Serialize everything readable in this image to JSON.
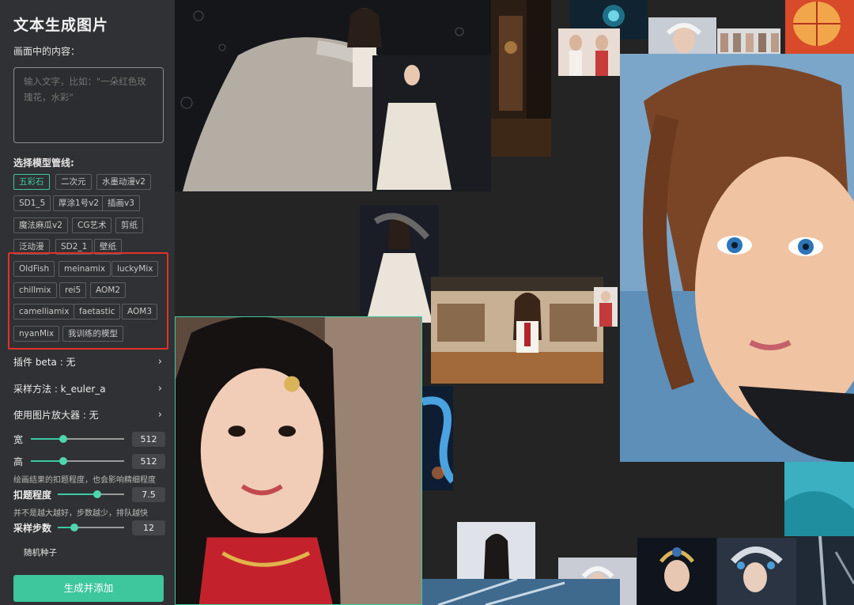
{
  "sidebar": {
    "title": "文本生成图片",
    "prompt_label": "画面中的内容：",
    "prompt_placeholder": "输入文字，比如：\"一朵红色玫瑰花，水彩\"",
    "pipeline_label": "选择模型管线:",
    "chips": [
      "五彩石",
      "二次元",
      "水墨动漫v2",
      "SD1_5",
      "厚涂1号v2",
      "插画v3",
      "魔法麻瓜v2",
      "CG艺术",
      "剪纸",
      "泛动漫",
      "SD2_1",
      "壁纸",
      "OldFish",
      "meinamix",
      "luckyMix",
      "chillmix",
      "rei5",
      "AOM2",
      "camelliamix",
      "faetastic",
      "AOM3",
      "nyanMix",
      "我训练的模型"
    ],
    "active_chip": "五彩石",
    "plugin_label": "插件 beta : 无",
    "sampler_label": "采样方法 : k_euler_a",
    "upscaler_label": "使用图片放大器 : 无",
    "width_label": "宽",
    "width_value": "512",
    "width_fraction": 0.35,
    "height_label": "高",
    "height_value": "512",
    "height_fraction": 0.35,
    "guidance_hint": "绘画结果的扣题程度，也会影响精细程度",
    "guidance_label": "扣题程度",
    "guidance_value": "7.5",
    "guidance_fraction": 0.6,
    "steps_hint": "并不是越大越好，步数越少，排队越快",
    "steps_label": "采样步数",
    "steps_value": "12",
    "steps_fraction": 0.25,
    "seed_label": "随机种子",
    "generate_label": "生成并添加"
  },
  "colors": {
    "accent": "#3cc9a2",
    "highlight": "#e0312b",
    "panel": "#303134",
    "background": "#242424"
  }
}
